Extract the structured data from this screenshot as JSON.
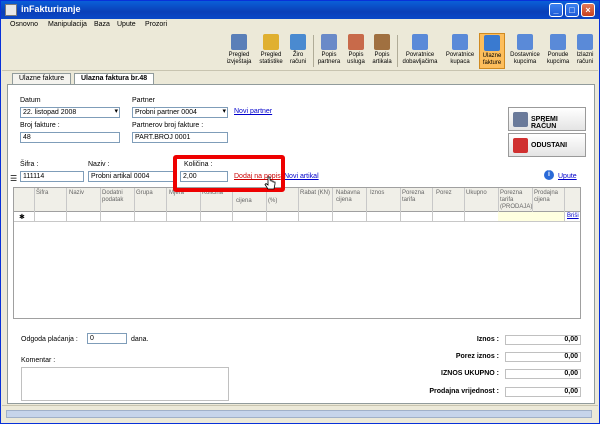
{
  "window": {
    "title": "inFakturiranje",
    "btn_min": "_",
    "btn_max": "□",
    "btn_close": "×"
  },
  "menu": [
    "Osnovno",
    "Manipulacija",
    "Baza",
    "Upute",
    "Prozori"
  ],
  "toolbar": [
    {
      "label": "Pregled izvještaja",
      "icon": "report-icon"
    },
    {
      "label": "Pregled statistike",
      "icon": "statistics-icon"
    },
    {
      "label": "Žiro računi",
      "icon": "bank-account-icon"
    },
    {
      "label": "Popis partnera",
      "icon": "partners-icon"
    },
    {
      "label": "Popis usluga",
      "icon": "services-icon"
    },
    {
      "label": "Popis artikala",
      "icon": "articles-icon"
    },
    {
      "label": "Povratnice dobavljačima",
      "icon": "supplier-return-icon"
    },
    {
      "label": "Povratnice kupaca",
      "icon": "customer-return-icon"
    },
    {
      "label": "Ulazne fakture",
      "icon": "incoming-invoices-icon",
      "active": true
    },
    {
      "label": "Dostavnice kupcima",
      "icon": "delivery-notes-icon"
    },
    {
      "label": "Ponude kupcima",
      "icon": "offers-icon"
    },
    {
      "label": "Izlazni računi",
      "icon": "outgoing-invoices-icon"
    }
  ],
  "tabs": [
    "Ulazne fakture",
    "Ulazna faktura br.48"
  ],
  "form": {
    "datum_label": "Datum",
    "datum_value": "22. listopad 2008",
    "partner_label": "Partner",
    "partner_value": "Probni partner 0004",
    "novi_partner": "Novi partner",
    "broj_fakture_label": "Broj fakture :",
    "broj_fakture_value": "48",
    "partnerov_broj_label": "Partnerov broj fakture :",
    "partnerov_broj_value": "PART.BROJ 0001",
    "sifra_label": "Šifra :",
    "sifra_value": "111114",
    "naziv_label": "Naziv :",
    "naziv_value": "Probni artikal 0004",
    "kolicina_label": "Količina :",
    "kolicina_value": "2,00",
    "dodaj_link": "Dodaj na popis",
    "novi_artikal": "Novi artikal",
    "upute": "Upute"
  },
  "buttons": {
    "spremi": "SPREMI RAČUN",
    "odustani": "ODUSTANI"
  },
  "grid": {
    "headers": [
      "Šifra",
      "Naziv",
      "Dodatni podatak",
      "Grupa",
      "Mjera",
      "Količina",
      "cijena",
      "(%)",
      "Rabat (KN)",
      "Nabavna cijena",
      "Iznos",
      "Porezna tarifa",
      "Porez",
      "Ukupno",
      "Porezna tarifa (PRODAJA)",
      "Prodajna cijena"
    ],
    "row_marker": "✱",
    "row_delete": "Briši"
  },
  "bottom": {
    "odgoda_label": "Odgoda plaćanja :",
    "odgoda_value": "0",
    "dana": "dana.",
    "komentar_label": "Komentar :"
  },
  "totals": [
    {
      "label": "Iznos :",
      "value": "0,00"
    },
    {
      "label": "Porez iznos :",
      "value": "0,00"
    },
    {
      "label": "IZNOS UKUPNO :",
      "value": "0,00"
    },
    {
      "label": "Prodajna vrijednost :",
      "value": "0,00"
    }
  ],
  "colors": {
    "accent": "#fdbe5c",
    "highlight": "#ee0000",
    "link": "#0000cc"
  }
}
